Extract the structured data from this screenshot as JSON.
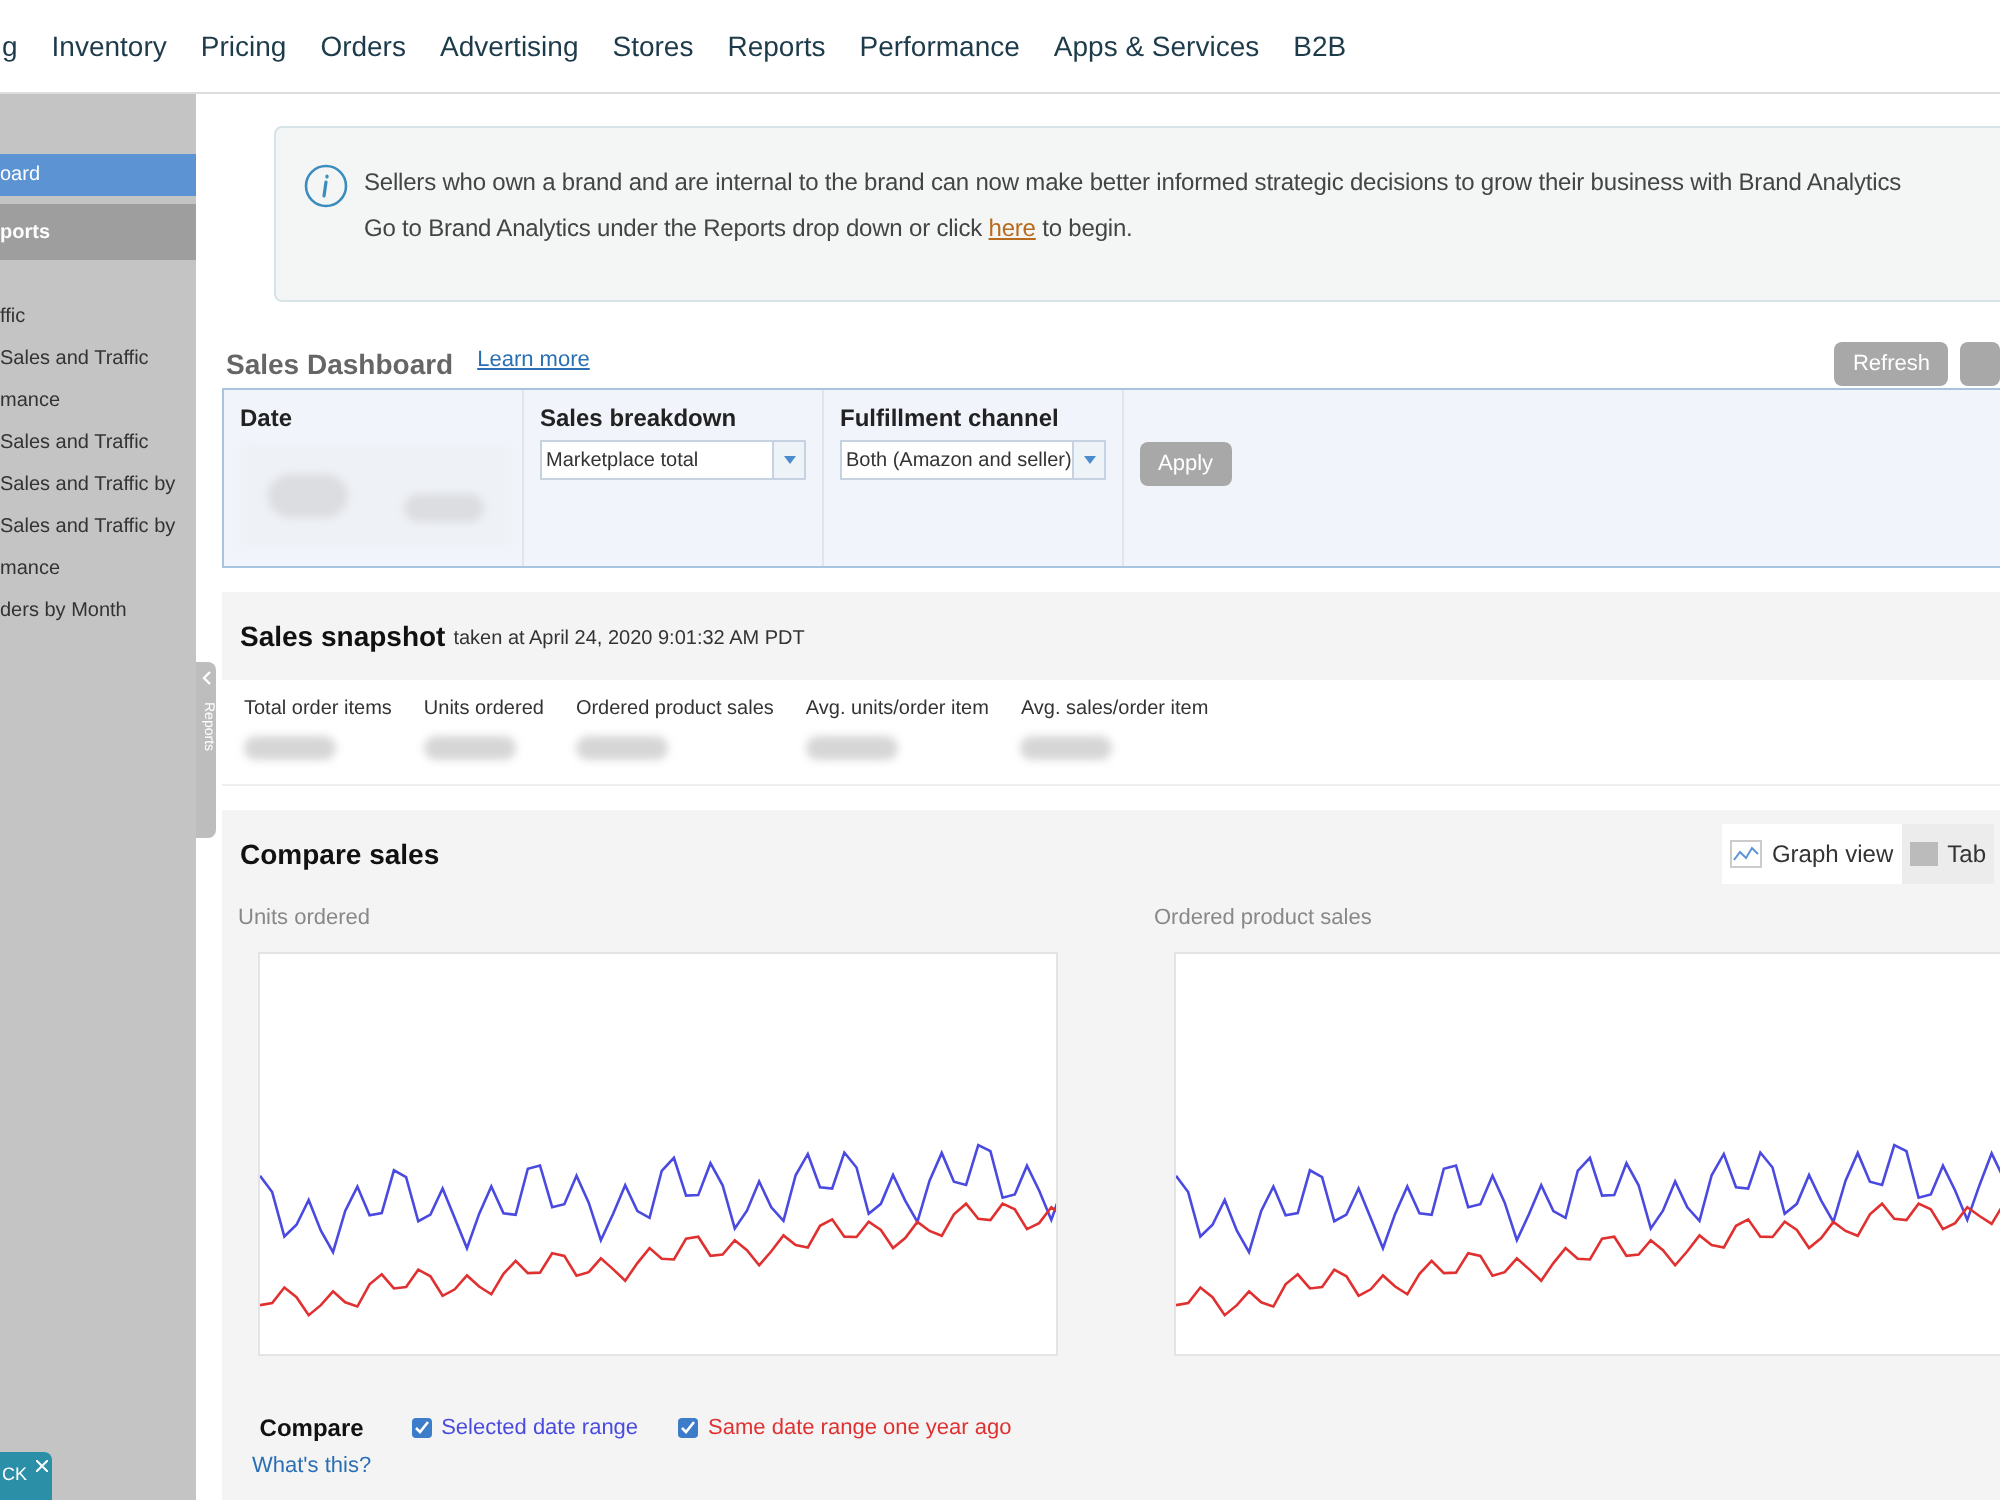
{
  "nav": {
    "items": [
      "g",
      "Inventory",
      "Pricing",
      "Orders",
      "Advertising",
      "Stores",
      "Reports",
      "Performance",
      "Apps & Services",
      "B2B"
    ]
  },
  "sidebar": {
    "items": [
      {
        "label": "oard",
        "kind": "item",
        "selected": true
      },
      {
        "label": "ports",
        "kind": "header",
        "selected": false
      },
      {
        "label": "ffic",
        "kind": "item",
        "selected": false
      },
      {
        "label": "Sales and Traffic",
        "kind": "item",
        "selected": false
      },
      {
        "label": "mance",
        "kind": "item",
        "selected": false
      },
      {
        "label": "Sales and Traffic",
        "kind": "item",
        "selected": false
      },
      {
        "label": "Sales and Traffic by",
        "kind": "item",
        "selected": false
      },
      {
        "label": "Sales and Traffic by",
        "kind": "item",
        "selected": false
      },
      {
        "label": "mance",
        "kind": "item",
        "selected": false
      },
      {
        "label": "ders by Month",
        "kind": "item",
        "selected": false
      }
    ],
    "tab": "Reports"
  },
  "info": {
    "line1": "Sellers who own a brand and are internal to the brand can now make better informed strategic decisions to grow their business with Brand Analytics",
    "before": "Go to Brand Analytics under the Reports drop down or click ",
    "link": "here",
    "after": " to begin."
  },
  "dashboard": {
    "title": "Sales Dashboard",
    "learn_more": "Learn more",
    "buttons": [
      "Refresh"
    ]
  },
  "filters": {
    "date_label": "Date",
    "selects": [
      {
        "label": "Sales breakdown",
        "value": "Marketplace total"
      },
      {
        "label": "Fulfillment channel",
        "value": "Both (Amazon and seller)"
      }
    ],
    "apply": "Apply"
  },
  "snapshot": {
    "title": "Sales snapshot",
    "subtitle": "taken at April 24, 2020 9:01:32 AM PDT",
    "metrics": [
      "Total order items",
      "Units ordered",
      "Ordered product sales",
      "Avg. units/order item",
      "Avg. sales/order item"
    ]
  },
  "compare": {
    "title": "Compare sales",
    "views": [
      {
        "label": "Graph view",
        "selected": true
      },
      {
        "label": "Tab",
        "selected": false
      }
    ],
    "charts": [
      "Units ordered",
      "Ordered product sales"
    ],
    "legend_title": "Compare",
    "whats_this": "What's this?",
    "series": [
      {
        "label": "Selected date range",
        "checked": true,
        "color": "#4a4ae0"
      },
      {
        "label": "Same date range one year ago",
        "checked": true,
        "color": "#e03030"
      }
    ]
  },
  "badge": "CK"
}
